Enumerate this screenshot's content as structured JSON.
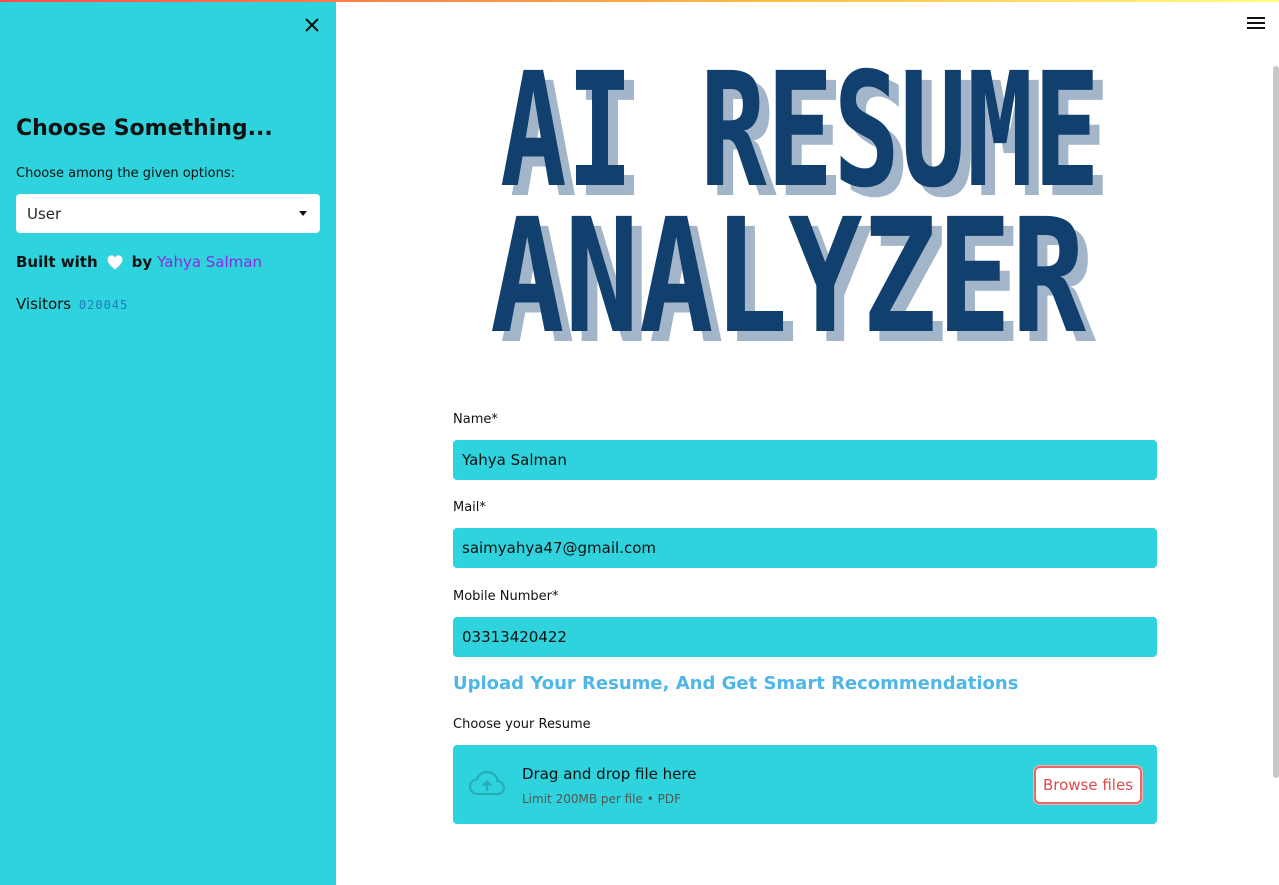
{
  "sidebar": {
    "heading": "Choose Something...",
    "select_label": "Choose among the given options:",
    "select_value": "User",
    "built_with_prefix": "Built with",
    "built_with_by": "by",
    "author": "Yahya Salman",
    "visitors_label": "Visitors",
    "visitors_count": "020045",
    "bg_color": "#2ed3dd"
  },
  "banner": {
    "line1": "AI RESUME",
    "line2": "ANALYZER",
    "text_color": "#12406e",
    "shadow_color": "#a3b5c9"
  },
  "form": {
    "name_label": "Name*",
    "name_value": "Yahya Salman",
    "mail_label": "Mail*",
    "mail_value": "saimyahya47@gmail.com",
    "mobile_label": "Mobile Number*",
    "mobile_value": "03313420422",
    "upload_heading": "Upload Your Resume, And Get Smart Recommendations",
    "resume_label": "Choose your Resume",
    "dropzone_title": "Drag and drop file here",
    "dropzone_sub": "Limit 200MB per file • PDF",
    "browse_label": "Browse files"
  },
  "icons": {
    "close": "close-icon",
    "menu": "hamburger-menu-icon",
    "heart": "white-heart-icon",
    "cloud": "cloud-upload-icon",
    "caret": "chevron-down-icon"
  }
}
